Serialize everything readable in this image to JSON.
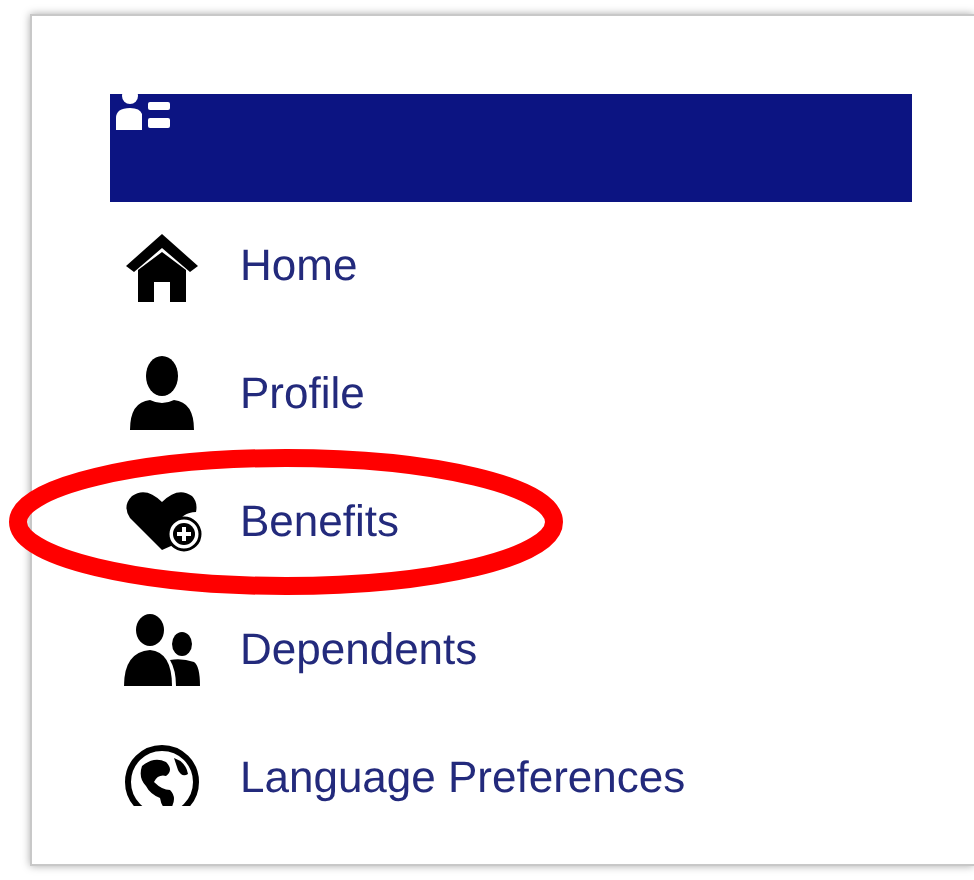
{
  "menu": {
    "items": [
      {
        "kind": "home",
        "label": "Home",
        "highlighted": false
      },
      {
        "kind": "profile",
        "label": "Profile",
        "highlighted": false
      },
      {
        "kind": "benefits",
        "label": "Benefits",
        "highlighted": true
      },
      {
        "kind": "dependents",
        "label": "Dependents",
        "highlighted": false
      },
      {
        "kind": "language",
        "label": "Language Preferences",
        "highlighted": false
      }
    ]
  }
}
